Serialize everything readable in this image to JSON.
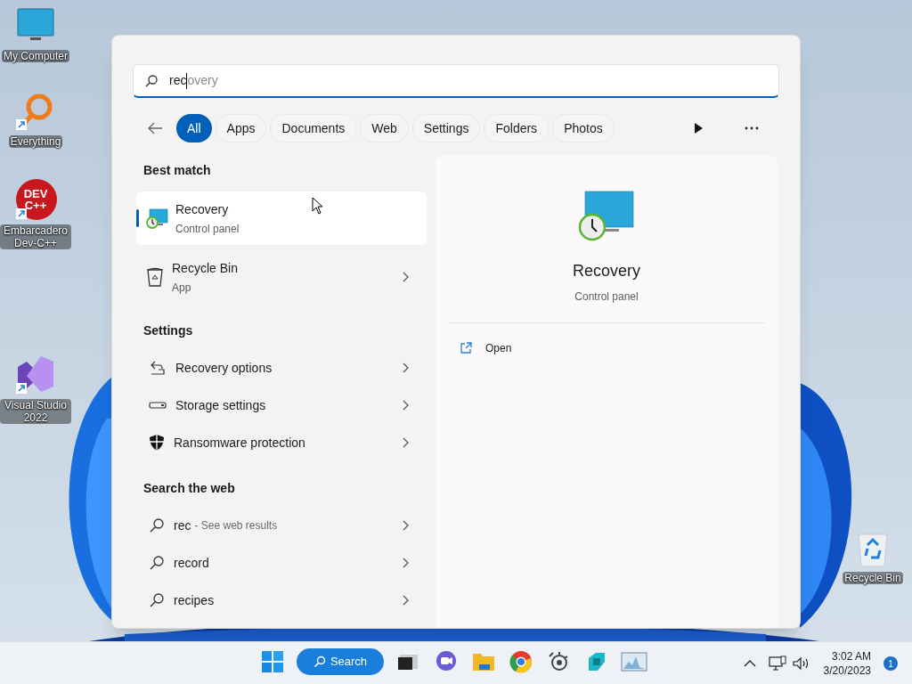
{
  "desktop_icons": [
    {
      "label": "My Computer",
      "kind": "monitor"
    },
    {
      "label": "Everything",
      "kind": "magnifier",
      "shortcut": true
    },
    {
      "label": "Embarcadero Dev-C++",
      "kind": "logo",
      "logo_lines": [
        "DEV",
        "C++"
      ],
      "shortcut": true
    },
    {
      "label": "Visual Studio 2022",
      "kind": "vs",
      "shortcut": true
    },
    {
      "label": "Recycle Bin",
      "kind": "bin"
    }
  ],
  "search": {
    "value": "rec",
    "completion": "overy"
  },
  "filters": [
    {
      "label": "All",
      "selected": true
    },
    {
      "label": "Apps",
      "selected": false
    },
    {
      "label": "Documents",
      "selected": false
    },
    {
      "label": "Web",
      "selected": false
    },
    {
      "label": "Settings",
      "selected": false
    },
    {
      "label": "Folders",
      "selected": false
    },
    {
      "label": "Photos",
      "selected": false
    }
  ],
  "sections": [
    {
      "heading": "Best match",
      "kind": "app",
      "items": [
        {
          "title": "Recovery",
          "subtitle": "Control panel",
          "selected": true
        },
        {
          "title": "Recycle Bin",
          "subtitle": "App",
          "selected": false
        }
      ]
    },
    {
      "heading": "Settings",
      "kind": "setting",
      "items": [
        {
          "title": "Recovery options"
        },
        {
          "title": "Storage settings"
        },
        {
          "title": "Ransomware protection"
        }
      ]
    },
    {
      "heading": "Search the web",
      "kind": "web",
      "items": [
        {
          "title": "rec",
          "suffix": "- See web results"
        },
        {
          "title": "record"
        },
        {
          "title": "recipes"
        }
      ]
    }
  ],
  "preview": {
    "title": "Recovery",
    "subtitle": "Control panel",
    "actions": [
      "Open"
    ]
  },
  "taskbar": {
    "search_label": "Search",
    "time": "3:02 AM",
    "date": "3/20/2023",
    "notifications": "1"
  }
}
